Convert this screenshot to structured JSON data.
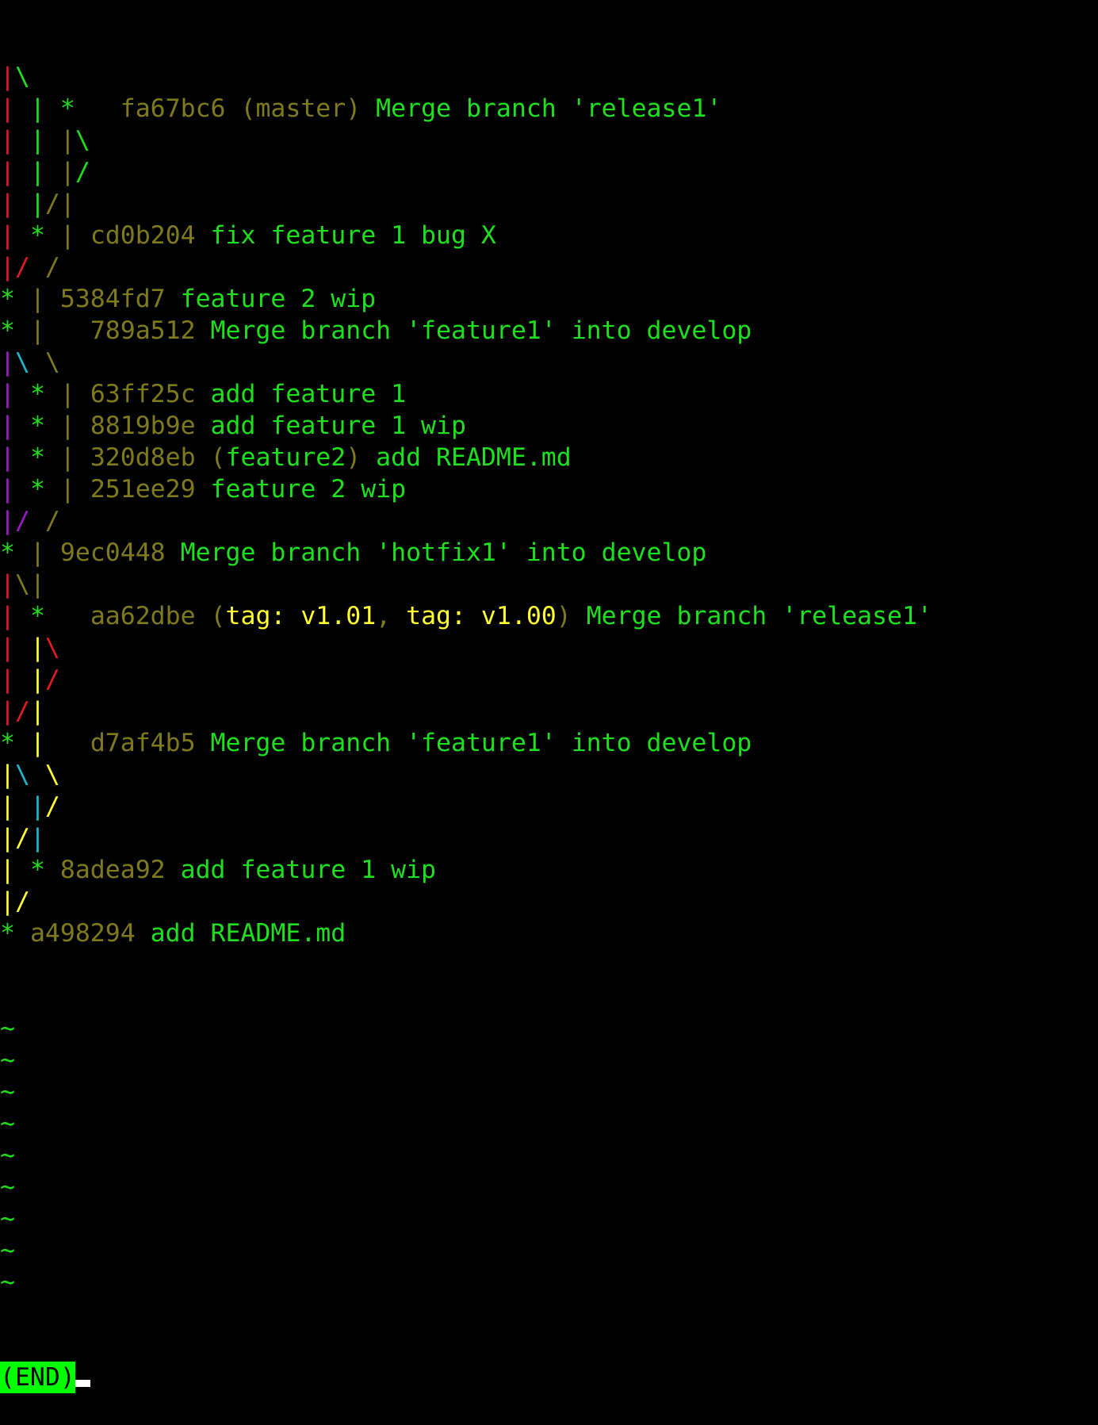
{
  "lines": [
    [
      {
        "t": "|",
        "c": "red"
      },
      {
        "t": "\\",
        "c": "green"
      }
    ],
    [
      {
        "t": "|",
        "c": "red"
      },
      {
        "t": " ",
        "c": ""
      },
      {
        "t": "|",
        "c": "green"
      },
      {
        "t": " ",
        "c": ""
      },
      {
        "t": "*",
        "c": "green"
      },
      {
        "t": "   ",
        "c": ""
      },
      {
        "t": "fa67bc6",
        "c": "olive"
      },
      {
        "t": " ",
        "c": ""
      },
      {
        "t": "(",
        "c": "olive"
      },
      {
        "t": "master",
        "c": "olive"
      },
      {
        "t": ")",
        "c": "olive"
      },
      {
        "t": " Merge branch 'release1'",
        "c": "green"
      }
    ],
    [
      {
        "t": "|",
        "c": "red"
      },
      {
        "t": " ",
        "c": ""
      },
      {
        "t": "|",
        "c": "green"
      },
      {
        "t": " ",
        "c": ""
      },
      {
        "t": "|",
        "c": "olive"
      },
      {
        "t": "\\",
        "c": "green"
      }
    ],
    [
      {
        "t": "|",
        "c": "red"
      },
      {
        "t": " ",
        "c": ""
      },
      {
        "t": "|",
        "c": "green"
      },
      {
        "t": " ",
        "c": ""
      },
      {
        "t": "|",
        "c": "olive"
      },
      {
        "t": "/",
        "c": "green"
      }
    ],
    [
      {
        "t": "|",
        "c": "red"
      },
      {
        "t": " ",
        "c": ""
      },
      {
        "t": "|",
        "c": "green"
      },
      {
        "t": "/",
        "c": "olive"
      },
      {
        "t": "|",
        "c": "olive"
      }
    ],
    [
      {
        "t": "|",
        "c": "red"
      },
      {
        "t": " ",
        "c": ""
      },
      {
        "t": "*",
        "c": "green"
      },
      {
        "t": " ",
        "c": ""
      },
      {
        "t": "|",
        "c": "olive"
      },
      {
        "t": " ",
        "c": ""
      },
      {
        "t": "cd0b204",
        "c": "olive"
      },
      {
        "t": " fix feature 1 bug X",
        "c": "green"
      }
    ],
    [
      {
        "t": "|",
        "c": "red"
      },
      {
        "t": "/",
        "c": "red"
      },
      {
        "t": " ",
        "c": ""
      },
      {
        "t": "/",
        "c": "olive"
      }
    ],
    [
      {
        "t": "*",
        "c": "green"
      },
      {
        "t": " ",
        "c": ""
      },
      {
        "t": "|",
        "c": "olive"
      },
      {
        "t": " ",
        "c": ""
      },
      {
        "t": "5384fd7",
        "c": "olive"
      },
      {
        "t": " feature 2 wip",
        "c": "green"
      }
    ],
    [
      {
        "t": "*",
        "c": "green"
      },
      {
        "t": " ",
        "c": ""
      },
      {
        "t": "|",
        "c": "olive"
      },
      {
        "t": "   ",
        "c": ""
      },
      {
        "t": "789a512",
        "c": "olive"
      },
      {
        "t": " Merge branch 'feature1' into develop",
        "c": "green"
      }
    ],
    [
      {
        "t": "|",
        "c": "purple"
      },
      {
        "t": "\\",
        "c": "cyan"
      },
      {
        "t": " ",
        "c": ""
      },
      {
        "t": "\\",
        "c": "olive"
      }
    ],
    [
      {
        "t": "|",
        "c": "purple"
      },
      {
        "t": " ",
        "c": ""
      },
      {
        "t": "*",
        "c": "green"
      },
      {
        "t": " ",
        "c": ""
      },
      {
        "t": "|",
        "c": "olive"
      },
      {
        "t": " ",
        "c": ""
      },
      {
        "t": "63ff25c",
        "c": "olive"
      },
      {
        "t": " add feature 1",
        "c": "green"
      }
    ],
    [
      {
        "t": "|",
        "c": "purple"
      },
      {
        "t": " ",
        "c": ""
      },
      {
        "t": "*",
        "c": "green"
      },
      {
        "t": " ",
        "c": ""
      },
      {
        "t": "|",
        "c": "olive"
      },
      {
        "t": " ",
        "c": ""
      },
      {
        "t": "8819b9e",
        "c": "olive"
      },
      {
        "t": " add feature 1 wip",
        "c": "green"
      }
    ],
    [
      {
        "t": "|",
        "c": "purple"
      },
      {
        "t": " ",
        "c": ""
      },
      {
        "t": "*",
        "c": "green"
      },
      {
        "t": " ",
        "c": ""
      },
      {
        "t": "|",
        "c": "olive"
      },
      {
        "t": " ",
        "c": ""
      },
      {
        "t": "320d8eb",
        "c": "olive"
      },
      {
        "t": " ",
        "c": ""
      },
      {
        "t": "(",
        "c": "olive"
      },
      {
        "t": "feature2",
        "c": "green"
      },
      {
        "t": ")",
        "c": "olive"
      },
      {
        "t": " add README.md",
        "c": "green"
      }
    ],
    [
      {
        "t": "|",
        "c": "purple"
      },
      {
        "t": " ",
        "c": ""
      },
      {
        "t": "*",
        "c": "green"
      },
      {
        "t": " ",
        "c": ""
      },
      {
        "t": "|",
        "c": "olive"
      },
      {
        "t": " ",
        "c": ""
      },
      {
        "t": "251ee29",
        "c": "olive"
      },
      {
        "t": " feature 2 wip",
        "c": "green"
      }
    ],
    [
      {
        "t": "|",
        "c": "purple"
      },
      {
        "t": "/",
        "c": "purple"
      },
      {
        "t": " ",
        "c": ""
      },
      {
        "t": "/",
        "c": "olive"
      }
    ],
    [
      {
        "t": "*",
        "c": "green"
      },
      {
        "t": " ",
        "c": ""
      },
      {
        "t": "|",
        "c": "olive"
      },
      {
        "t": " ",
        "c": ""
      },
      {
        "t": "9ec0448",
        "c": "olive"
      },
      {
        "t": " Merge branch 'hotfix1' into develop",
        "c": "green"
      }
    ],
    [
      {
        "t": "|",
        "c": "red"
      },
      {
        "t": "\\",
        "c": "olive"
      },
      {
        "t": "|",
        "c": "olive"
      }
    ],
    [
      {
        "t": "|",
        "c": "red"
      },
      {
        "t": " ",
        "c": ""
      },
      {
        "t": "*",
        "c": "green"
      },
      {
        "t": "   ",
        "c": ""
      },
      {
        "t": "aa62dbe",
        "c": "olive"
      },
      {
        "t": " ",
        "c": ""
      },
      {
        "t": "(",
        "c": "olive"
      },
      {
        "t": "tag: v1.01",
        "c": "yellow"
      },
      {
        "t": ", ",
        "c": "olive"
      },
      {
        "t": "tag: v1.00",
        "c": "yellow"
      },
      {
        "t": ")",
        "c": "olive"
      },
      {
        "t": " Merge branch 'release1'",
        "c": "green"
      }
    ],
    [
      {
        "t": "|",
        "c": "red"
      },
      {
        "t": " ",
        "c": ""
      },
      {
        "t": "|",
        "c": "yellow"
      },
      {
        "t": "\\",
        "c": "red"
      }
    ],
    [
      {
        "t": "|",
        "c": "red"
      },
      {
        "t": " ",
        "c": ""
      },
      {
        "t": "|",
        "c": "yellow"
      },
      {
        "t": "/",
        "c": "red"
      }
    ],
    [
      {
        "t": "|",
        "c": "red"
      },
      {
        "t": "/",
        "c": "red"
      },
      {
        "t": "|",
        "c": "yellow"
      }
    ],
    [
      {
        "t": "*",
        "c": "green"
      },
      {
        "t": " ",
        "c": ""
      },
      {
        "t": "|",
        "c": "yellow"
      },
      {
        "t": "   ",
        "c": ""
      },
      {
        "t": "d7af4b5",
        "c": "olive"
      },
      {
        "t": " Merge branch 'feature1' into develop",
        "c": "green"
      }
    ],
    [
      {
        "t": "|",
        "c": "yellow"
      },
      {
        "t": "\\",
        "c": "cyan"
      },
      {
        "t": " ",
        "c": ""
      },
      {
        "t": "\\",
        "c": "yellow"
      }
    ],
    [
      {
        "t": "|",
        "c": "yellow"
      },
      {
        "t": " ",
        "c": ""
      },
      {
        "t": "|",
        "c": "cyan"
      },
      {
        "t": "/",
        "c": "yellow"
      }
    ],
    [
      {
        "t": "|",
        "c": "yellow"
      },
      {
        "t": "/",
        "c": "yellow"
      },
      {
        "t": "|",
        "c": "cyan"
      }
    ],
    [
      {
        "t": "|",
        "c": "yellow"
      },
      {
        "t": " ",
        "c": ""
      },
      {
        "t": "*",
        "c": "green"
      },
      {
        "t": " ",
        "c": ""
      },
      {
        "t": "8adea92",
        "c": "olive"
      },
      {
        "t": " add feature 1 wip",
        "c": "green"
      }
    ],
    [
      {
        "t": "|",
        "c": "yellow"
      },
      {
        "t": "/",
        "c": "yellow"
      }
    ],
    [
      {
        "t": "*",
        "c": "green"
      },
      {
        "t": " ",
        "c": ""
      },
      {
        "t": "a498294",
        "c": "olive"
      },
      {
        "t": " add README.md",
        "c": "green"
      }
    ]
  ],
  "filler": [
    "~",
    "~",
    "~",
    "~",
    "~",
    "~",
    "~",
    "~",
    "~"
  ],
  "status": {
    "label": "(END)"
  },
  "colors": {
    "background": "#000000",
    "red": "#e01b24",
    "green": "#1ee01e",
    "olive": "#7f7a1c",
    "yellow": "#ffff33",
    "purple": "#9b1cc6",
    "cyan": "#1bb8d6",
    "status_bg": "#00ff00",
    "cursor": "#ffffff"
  }
}
